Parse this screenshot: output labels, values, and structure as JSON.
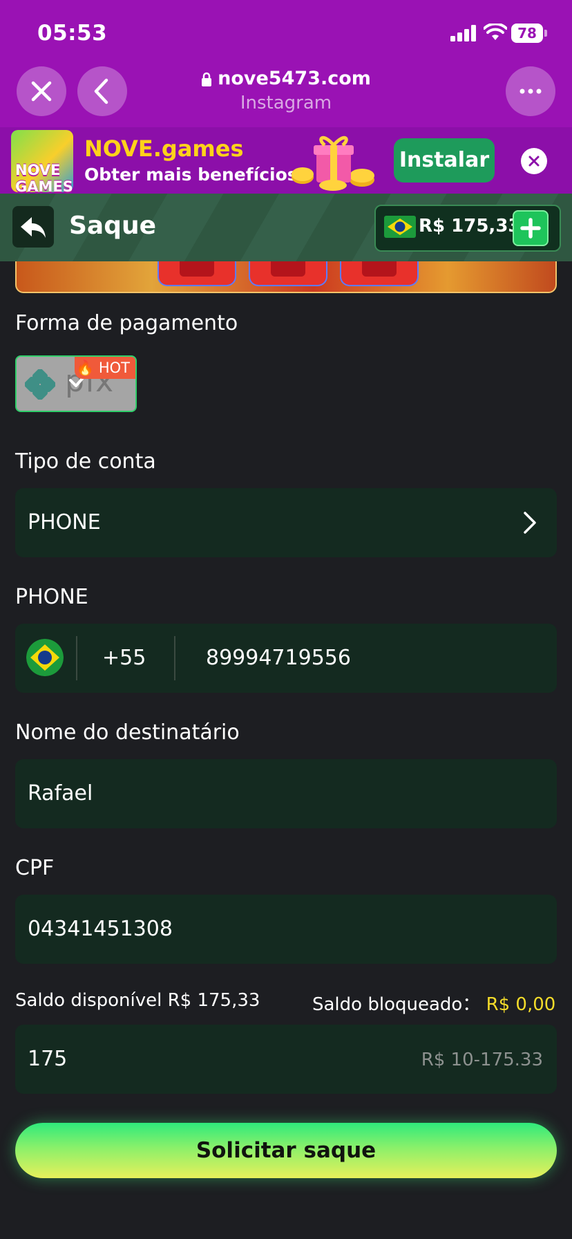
{
  "status_bar": {
    "time": "05:53",
    "battery": "78"
  },
  "browser": {
    "url": "nove5473.com",
    "source": "Instagram"
  },
  "install_banner": {
    "title": "NOVE.games",
    "subtitle": "Obter mais benefícios",
    "install_label": "Instalar",
    "logo_text": "NOVE GAMES"
  },
  "app_header": {
    "title": "Saque",
    "balance": "R$ 175,33"
  },
  "payment": {
    "label": "Forma de pagamento",
    "method_badge": "HOT",
    "method_name": "pix"
  },
  "account_type": {
    "label": "Tipo de conta",
    "value": "PHONE"
  },
  "phone": {
    "label": "PHONE",
    "country_code": "+55",
    "number": "89994719556"
  },
  "recipient": {
    "label": "Nome do destinatário",
    "value": "Rafael"
  },
  "cpf": {
    "label": "CPF",
    "value": "04341451308"
  },
  "balance_info": {
    "available_label": "Saldo disponível R$",
    "available_value": "175,33",
    "blocked_label": "Saldo bloqueado：",
    "blocked_value": "R$ 0,00"
  },
  "amount": {
    "value": "175",
    "range_hint": "R$ 10-175.33"
  },
  "submit": {
    "label": "Solicitar saque"
  },
  "colors": {
    "accent_green": "#1ec45b",
    "field_bg": "#142a20",
    "browser_purple": "#9a12b4",
    "blocked_yellow": "#f4dc2a"
  }
}
